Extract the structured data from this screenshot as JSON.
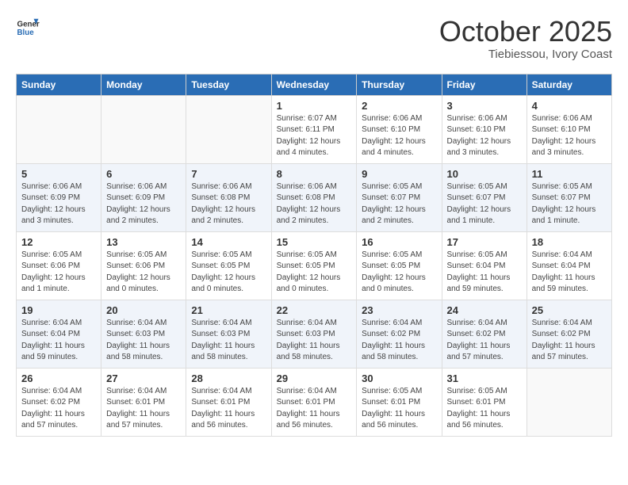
{
  "header": {
    "logo": {
      "general": "General",
      "blue": "Blue"
    },
    "title": "October 2025",
    "subtitle": "Tiebiessou, Ivory Coast"
  },
  "days_of_week": [
    "Sunday",
    "Monday",
    "Tuesday",
    "Wednesday",
    "Thursday",
    "Friday",
    "Saturday"
  ],
  "weeks": [
    [
      {
        "day": "",
        "info": ""
      },
      {
        "day": "",
        "info": ""
      },
      {
        "day": "",
        "info": ""
      },
      {
        "day": "1",
        "info": "Sunrise: 6:07 AM\nSunset: 6:11 PM\nDaylight: 12 hours\nand 4 minutes."
      },
      {
        "day": "2",
        "info": "Sunrise: 6:06 AM\nSunset: 6:10 PM\nDaylight: 12 hours\nand 4 minutes."
      },
      {
        "day": "3",
        "info": "Sunrise: 6:06 AM\nSunset: 6:10 PM\nDaylight: 12 hours\nand 3 minutes."
      },
      {
        "day": "4",
        "info": "Sunrise: 6:06 AM\nSunset: 6:10 PM\nDaylight: 12 hours\nand 3 minutes."
      }
    ],
    [
      {
        "day": "5",
        "info": "Sunrise: 6:06 AM\nSunset: 6:09 PM\nDaylight: 12 hours\nand 3 minutes."
      },
      {
        "day": "6",
        "info": "Sunrise: 6:06 AM\nSunset: 6:09 PM\nDaylight: 12 hours\nand 2 minutes."
      },
      {
        "day": "7",
        "info": "Sunrise: 6:06 AM\nSunset: 6:08 PM\nDaylight: 12 hours\nand 2 minutes."
      },
      {
        "day": "8",
        "info": "Sunrise: 6:06 AM\nSunset: 6:08 PM\nDaylight: 12 hours\nand 2 minutes."
      },
      {
        "day": "9",
        "info": "Sunrise: 6:05 AM\nSunset: 6:07 PM\nDaylight: 12 hours\nand 2 minutes."
      },
      {
        "day": "10",
        "info": "Sunrise: 6:05 AM\nSunset: 6:07 PM\nDaylight: 12 hours\nand 1 minute."
      },
      {
        "day": "11",
        "info": "Sunrise: 6:05 AM\nSunset: 6:07 PM\nDaylight: 12 hours\nand 1 minute."
      }
    ],
    [
      {
        "day": "12",
        "info": "Sunrise: 6:05 AM\nSunset: 6:06 PM\nDaylight: 12 hours\nand 1 minute."
      },
      {
        "day": "13",
        "info": "Sunrise: 6:05 AM\nSunset: 6:06 PM\nDaylight: 12 hours\nand 0 minutes."
      },
      {
        "day": "14",
        "info": "Sunrise: 6:05 AM\nSunset: 6:05 PM\nDaylight: 12 hours\nand 0 minutes."
      },
      {
        "day": "15",
        "info": "Sunrise: 6:05 AM\nSunset: 6:05 PM\nDaylight: 12 hours\nand 0 minutes."
      },
      {
        "day": "16",
        "info": "Sunrise: 6:05 AM\nSunset: 6:05 PM\nDaylight: 12 hours\nand 0 minutes."
      },
      {
        "day": "17",
        "info": "Sunrise: 6:05 AM\nSunset: 6:04 PM\nDaylight: 11 hours\nand 59 minutes."
      },
      {
        "day": "18",
        "info": "Sunrise: 6:04 AM\nSunset: 6:04 PM\nDaylight: 11 hours\nand 59 minutes."
      }
    ],
    [
      {
        "day": "19",
        "info": "Sunrise: 6:04 AM\nSunset: 6:04 PM\nDaylight: 11 hours\nand 59 minutes."
      },
      {
        "day": "20",
        "info": "Sunrise: 6:04 AM\nSunset: 6:03 PM\nDaylight: 11 hours\nand 58 minutes."
      },
      {
        "day": "21",
        "info": "Sunrise: 6:04 AM\nSunset: 6:03 PM\nDaylight: 11 hours\nand 58 minutes."
      },
      {
        "day": "22",
        "info": "Sunrise: 6:04 AM\nSunset: 6:03 PM\nDaylight: 11 hours\nand 58 minutes."
      },
      {
        "day": "23",
        "info": "Sunrise: 6:04 AM\nSunset: 6:02 PM\nDaylight: 11 hours\nand 58 minutes."
      },
      {
        "day": "24",
        "info": "Sunrise: 6:04 AM\nSunset: 6:02 PM\nDaylight: 11 hours\nand 57 minutes."
      },
      {
        "day": "25",
        "info": "Sunrise: 6:04 AM\nSunset: 6:02 PM\nDaylight: 11 hours\nand 57 minutes."
      }
    ],
    [
      {
        "day": "26",
        "info": "Sunrise: 6:04 AM\nSunset: 6:02 PM\nDaylight: 11 hours\nand 57 minutes."
      },
      {
        "day": "27",
        "info": "Sunrise: 6:04 AM\nSunset: 6:01 PM\nDaylight: 11 hours\nand 57 minutes."
      },
      {
        "day": "28",
        "info": "Sunrise: 6:04 AM\nSunset: 6:01 PM\nDaylight: 11 hours\nand 56 minutes."
      },
      {
        "day": "29",
        "info": "Sunrise: 6:04 AM\nSunset: 6:01 PM\nDaylight: 11 hours\nand 56 minutes."
      },
      {
        "day": "30",
        "info": "Sunrise: 6:05 AM\nSunset: 6:01 PM\nDaylight: 11 hours\nand 56 minutes."
      },
      {
        "day": "31",
        "info": "Sunrise: 6:05 AM\nSunset: 6:01 PM\nDaylight: 11 hours\nand 56 minutes."
      },
      {
        "day": "",
        "info": ""
      }
    ]
  ]
}
